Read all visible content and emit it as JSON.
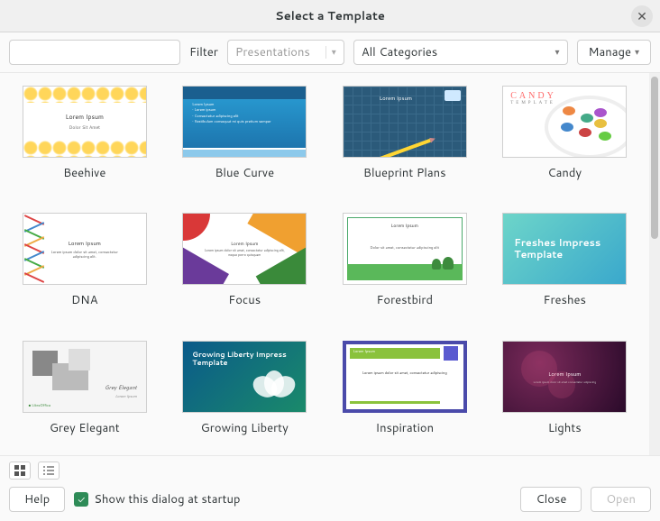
{
  "window": {
    "title": "Select a Template"
  },
  "toolbar": {
    "search_value": "",
    "search_placeholder": "",
    "filter_label": "Filter",
    "filter_combo": "Presentations",
    "category_combo": "All Categories",
    "manage_label": "Manage"
  },
  "templates": [
    {
      "id": "beehive",
      "label": "Beehive"
    },
    {
      "id": "bluecurve",
      "label": "Blue Curve"
    },
    {
      "id": "blueprint",
      "label": "Blueprint Plans"
    },
    {
      "id": "candy",
      "label": "Candy"
    },
    {
      "id": "dna",
      "label": "DNA"
    },
    {
      "id": "focus",
      "label": "Focus"
    },
    {
      "id": "forestbird",
      "label": "Forestbird"
    },
    {
      "id": "freshes",
      "label": "Freshes"
    },
    {
      "id": "greyelegant",
      "label": "Grey Elegant"
    },
    {
      "id": "growingliberty",
      "label": "Growing Liberty"
    },
    {
      "id": "inspiration",
      "label": "Inspiration"
    },
    {
      "id": "lights",
      "label": "Lights"
    }
  ],
  "thumb_text": {
    "beehive_title": "Lorem Ipsum",
    "beehive_sub": "Dolor Sit Amet",
    "bluecurve_title": "Lorem Ipsum",
    "blueprint_title": "Lorem Ipsum",
    "candy_logo": "CANDY",
    "candy_sub": "TEMPLATE",
    "dna_title": "Lorem Ipsum",
    "dna_body": "Lorem ipsum dolor sit amet, consectetur adipiscing elit.",
    "focus_title": "Lorem Ipsum",
    "focus_body": "Lorem ipsum dolor sit amet, consectetur adipiscing elit, neque porro quisquam",
    "forest_title": "Lorem Ipsum",
    "forest_body": "Dolor sit amet, consectetur adipiscing elit",
    "freshes_title": "Freshes Impress Template",
    "grey_title": "Grey Elegant",
    "grey_sub": "Lorem Ipsum",
    "growing_title": "Growing Liberty Impress Template",
    "insp_body": "Lorem ipsum dolor sit amet, consectetur adipiscing",
    "lights_title": "Lorem Ipsum",
    "lights_body": "Lorem ipsum dolor sit amet consectetur adipiscing"
  },
  "footer": {
    "startup_checkbox": "Show this dialog at startup",
    "startup_checked": true,
    "help": "Help",
    "close": "Close",
    "open": "Open"
  }
}
